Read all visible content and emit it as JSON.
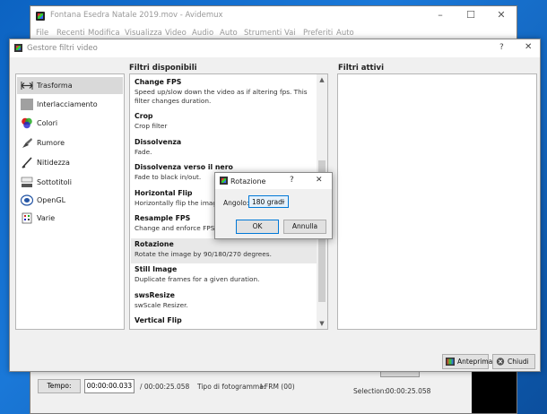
{
  "main_window": {
    "title": "Fontana Esedra Natale 2019.mov - Avidemux",
    "menu": [
      "File",
      "Recenti",
      "Modifica",
      "Visualizza",
      "Video",
      "Audio",
      "Auto",
      "Strumenti",
      "Vai",
      "Preferiti",
      "Auto"
    ],
    "time_label": "Tempo:",
    "time_value": "00:00:00.033",
    "total_time": "/ 00:00:25.058",
    "frame_type": "Tipo di fotogramma:",
    "frame_type_value": "I-FRM (00)",
    "selection_label": "Selection:",
    "selection_value": "00:00:25.058"
  },
  "filter_manager": {
    "title": "Gestore filtri video",
    "help": "?",
    "close": "✕",
    "available_header": "Filtri disponibili",
    "active_header": "Filtri attivi",
    "categories": [
      {
        "label": "Trasforma",
        "icon": "transform-icon"
      },
      {
        "label": "Interlacciamento",
        "icon": "interlace-icon"
      },
      {
        "label": "Colori",
        "icon": "colors-icon"
      },
      {
        "label": "Rumore",
        "icon": "noise-icon"
      },
      {
        "label": "Nitidezza",
        "icon": "sharpness-icon"
      },
      {
        "label": "Sottotitoli",
        "icon": "subtitles-icon"
      },
      {
        "label": "OpenGL",
        "icon": "opengl-icon"
      },
      {
        "label": "Varie",
        "icon": "misc-icon"
      }
    ],
    "filters": [
      {
        "name": "Change FPS",
        "desc": "Speed up/slow down the video as if altering fps. This filter changes duration."
      },
      {
        "name": "Crop",
        "desc": "Crop filter"
      },
      {
        "name": "Dissolvenza",
        "desc": "Fade."
      },
      {
        "name": "Dissolvenza verso il nero",
        "desc": "Fade to black in/out."
      },
      {
        "name": "Horizontal Flip",
        "desc": "Horizontally flip the image."
      },
      {
        "name": "Resample FPS",
        "desc": "Change and enforce FPS. Kee"
      },
      {
        "name": "Rotazione",
        "desc": "Rotate the image by 90/180/270 degrees."
      },
      {
        "name": "Still Image",
        "desc": "Duplicate frames for a given duration."
      },
      {
        "name": "swsResize",
        "desc": "swScale Resizer."
      },
      {
        "name": "Vertical Flip",
        "desc": ""
      }
    ],
    "preview_button": "Anteprima",
    "close_button": "Chiudi"
  },
  "rotation_dialog": {
    "title": "Rotazione",
    "help": "?",
    "close": "✕",
    "angle_label": "Angolo:",
    "angle_value": "180 gradi",
    "ok": "OK",
    "cancel": "Annulla"
  },
  "colors": {
    "desktop": "#0c63c2",
    "accent": "#0078d7",
    "selection": "#d9d9d9"
  }
}
